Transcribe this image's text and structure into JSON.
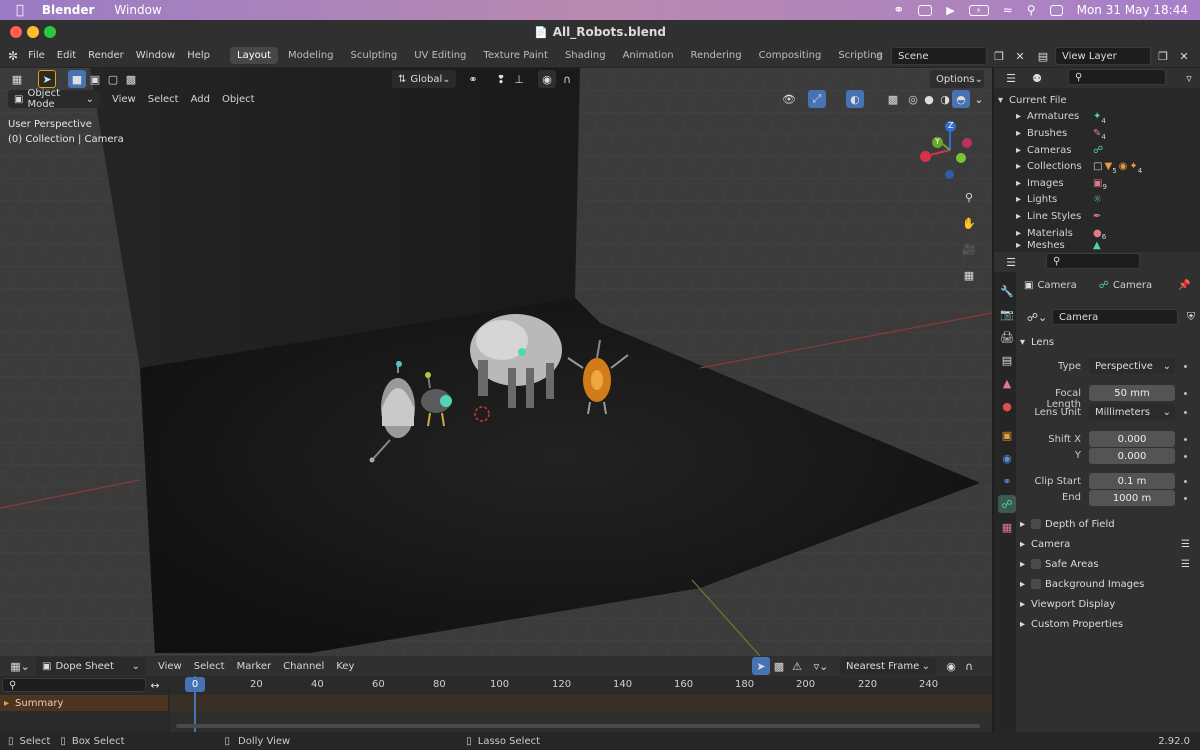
{
  "macos": {
    "app_name": "Blender",
    "menu": "Window",
    "clock": "Mon 31 May  18:44"
  },
  "window": {
    "title": "All_Robots.blend"
  },
  "top_menu": [
    "File",
    "Edit",
    "Render",
    "Window",
    "Help"
  ],
  "workspaces": [
    {
      "label": "Layout",
      "active": true
    },
    {
      "label": "Modeling",
      "active": false
    },
    {
      "label": "Sculpting",
      "active": false
    },
    {
      "label": "UV Editing",
      "active": false
    },
    {
      "label": "Texture Paint",
      "active": false
    },
    {
      "label": "Shading",
      "active": false
    },
    {
      "label": "Animation",
      "active": false
    },
    {
      "label": "Rendering",
      "active": false
    },
    {
      "label": "Compositing",
      "active": false
    },
    {
      "label": "Scripting",
      "active": false
    }
  ],
  "scene": {
    "label": "Scene"
  },
  "view_layer": {
    "label": "View Layer"
  },
  "viewport": {
    "transform_orientation": "Global",
    "options_label": "Options",
    "mode": "Object Mode",
    "menus": [
      "View",
      "Select",
      "Add",
      "Object"
    ],
    "overlay_line1": "User Perspective",
    "overlay_line2": "(0) Collection | Camera",
    "gizmo_axes": [
      "X",
      "Y",
      "Z"
    ]
  },
  "outliner": {
    "root": "Current File",
    "items": [
      {
        "label": "Armatures",
        "badge": "4"
      },
      {
        "label": "Brushes",
        "badge": "4"
      },
      {
        "label": "Cameras",
        "badge": ""
      },
      {
        "label": "Collections",
        "badge": "4"
      },
      {
        "label": "Images",
        "badge": "9"
      },
      {
        "label": "Lights",
        "badge": ""
      },
      {
        "label": "Line Styles",
        "badge": ""
      },
      {
        "label": "Materials",
        "badge": "6"
      },
      {
        "label": "Meshes",
        "badge": ""
      }
    ],
    "collections_extra_badge": "5"
  },
  "properties": {
    "breadcrumb_object": "Camera",
    "breadcrumb_data": "Camera",
    "datablock": "Camera",
    "lens_section": "Lens",
    "fields": {
      "type_label": "Type",
      "type_value": "Perspective",
      "focal_label": "Focal Length",
      "focal_value": "50 mm",
      "lensunit_label": "Lens Unit",
      "lensunit_value": "Millimeters",
      "shiftx_label": "Shift X",
      "shiftx_value": "0.000",
      "shifty_label": "Y",
      "shifty_value": "0.000",
      "clipstart_label": "Clip Start",
      "clipstart_value": "0.1 m",
      "clipend_label": "End",
      "clipend_value": "1000 m"
    },
    "sections": [
      {
        "label": "Depth of Field",
        "checkbox": true,
        "list_icon": false
      },
      {
        "label": "Camera",
        "checkbox": false,
        "list_icon": true
      },
      {
        "label": "Safe Areas",
        "checkbox": true,
        "list_icon": true
      },
      {
        "label": "Background Images",
        "checkbox": true,
        "list_icon": false
      },
      {
        "label": "Viewport Display",
        "checkbox": false,
        "list_icon": false
      },
      {
        "label": "Custom Properties",
        "checkbox": false,
        "list_icon": false
      }
    ]
  },
  "dopesheet": {
    "editor": "Dope Sheet",
    "menus": [
      "View",
      "Select",
      "Marker",
      "Channel",
      "Key"
    ],
    "snap": "Nearest Frame",
    "current_frame": "0",
    "ticks": [
      "20",
      "40",
      "60",
      "80",
      "100",
      "120",
      "140",
      "160",
      "180",
      "200",
      "220",
      "240"
    ],
    "summary": "Summary"
  },
  "statusbar": {
    "select": "Select",
    "box_select": "Box Select",
    "dolly": "Dolly View",
    "lasso": "Lasso Select",
    "version": "2.92.0"
  }
}
